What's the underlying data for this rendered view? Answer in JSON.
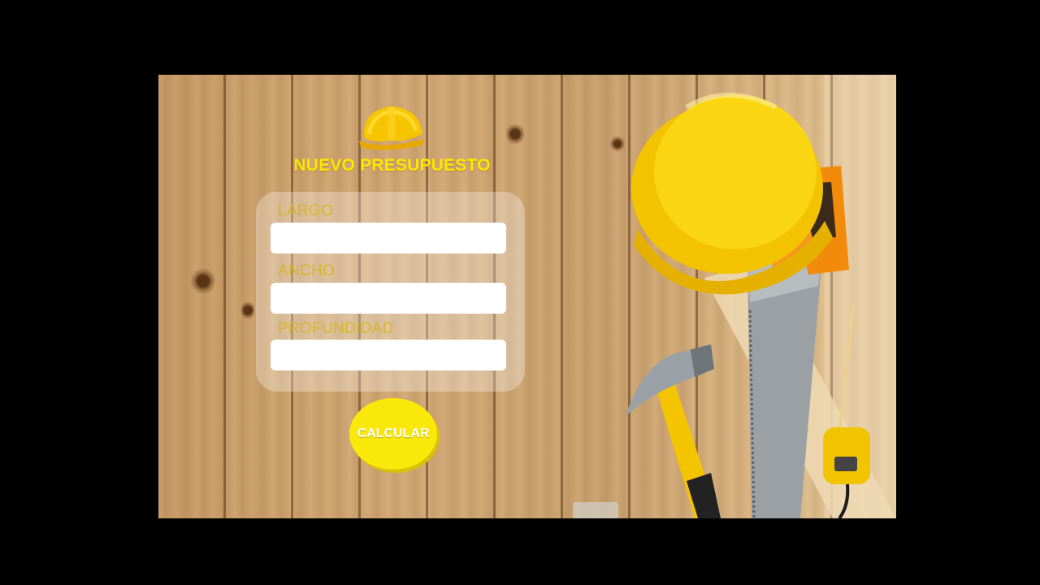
{
  "form": {
    "title": "NUEVO PRESUPUESTO",
    "logo_icon": "hard-hat-icon",
    "fields": [
      {
        "label": "LARGO",
        "value": "",
        "placeholder": ""
      },
      {
        "label": "ANCHO",
        "value": "",
        "placeholder": ""
      },
      {
        "label": "PROFUNDIDAD",
        "value": "",
        "placeholder": ""
      }
    ],
    "calculate_label": "CALCULAR"
  },
  "background": {
    "description_icons": [
      "hard-hat-icon",
      "saw-icon",
      "hammer-icon",
      "tape-measure-icon"
    ]
  },
  "colors": {
    "accent_yellow": "#ffe600",
    "button_yellow": "#fae80b",
    "label_gold": "#d6b52e",
    "frame": "#000000"
  }
}
